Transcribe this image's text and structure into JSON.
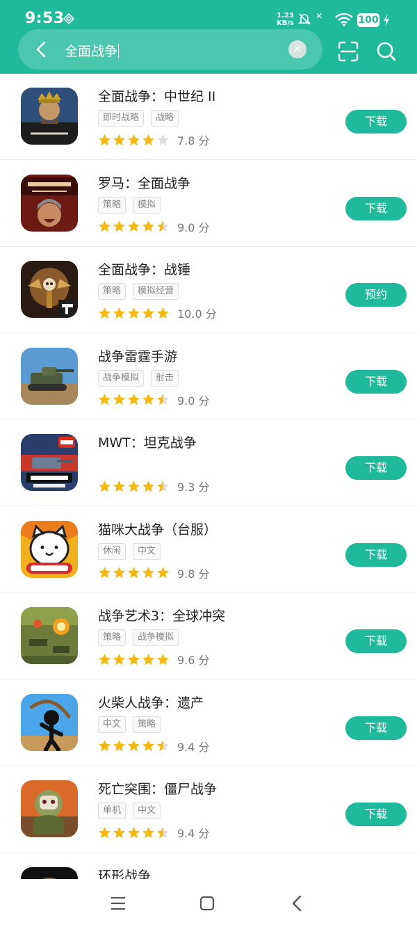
{
  "status_bar": {
    "time": "9:53",
    "net_speed_value": "1.23",
    "net_speed_unit": "KB/s",
    "battery": "100"
  },
  "search": {
    "query": "全面战争"
  },
  "colors": {
    "accent": "#1fb99b",
    "star": "#f5b80f",
    "star_empty": "#dddddd"
  },
  "apps": [
    {
      "title": "全面战争：中世纪 II",
      "tags": [
        "即时战略",
        "战略"
      ],
      "stars": 4,
      "score": "7.8 分",
      "action": "下载",
      "icon": "medieval-ii-icon"
    },
    {
      "title": "罗马：全面战争",
      "tags": [
        "策略",
        "模拟"
      ],
      "stars": 4.5,
      "score": "9.0 分",
      "action": "下载",
      "icon": "rome-total-war-icon"
    },
    {
      "title": "全面战争：战锤",
      "tags": [
        "策略",
        "模拟经营"
      ],
      "stars": 5,
      "score": "10.0 分",
      "action": "预约",
      "icon": "warhammer-icon"
    },
    {
      "title": "战争雷霆手游",
      "tags": [
        "战争模拟",
        "射击"
      ],
      "stars": 4.5,
      "score": "9.0 分",
      "action": "下载",
      "icon": "tank-icon"
    },
    {
      "title": "MWT：坦克战争",
      "tags": [],
      "stars": 4.5,
      "score": "9.3 分",
      "action": "下载",
      "icon": "mwt-tank-icon"
    },
    {
      "title": "猫咪大战争（台服）",
      "tags": [
        "休闲",
        "中文"
      ],
      "stars": 5,
      "score": "9.8 分",
      "action": "下载",
      "icon": "battle-cats-icon"
    },
    {
      "title": "战争艺术3：全球冲突",
      "tags": [
        "策略",
        "战争模拟"
      ],
      "stars": 5,
      "score": "9.6 分",
      "action": "下载",
      "icon": "art-of-war-icon"
    },
    {
      "title": "火柴人战争：遗产",
      "tags": [
        "中文",
        "策略"
      ],
      "stars": 4.5,
      "score": "9.4 分",
      "action": "下载",
      "icon": "stick-war-icon"
    },
    {
      "title": "死亡突围：僵尸战争",
      "tags": [
        "单机",
        "中文"
      ],
      "stars": 4.5,
      "score": "9.4 分",
      "action": "下载",
      "icon": "zombie-war-icon"
    },
    {
      "title": "环形战争",
      "tags": [],
      "stars": 0,
      "score": "",
      "action": "",
      "icon": "ring-war-icon"
    }
  ]
}
